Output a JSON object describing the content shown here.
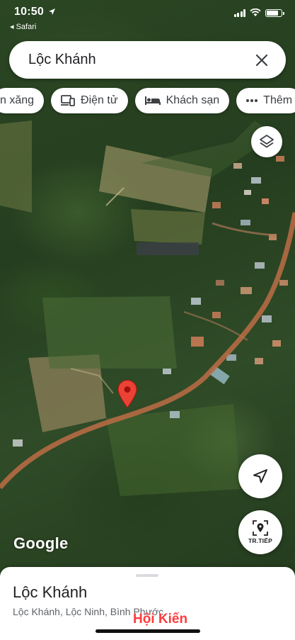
{
  "status_bar": {
    "time": "10:50",
    "back_app": "◂ Safari"
  },
  "search": {
    "query": "Lộc Khánh"
  },
  "chips": [
    {
      "label": "n xăng",
      "icon": ""
    },
    {
      "label": "Điện tử",
      "icon": "devices-icon"
    },
    {
      "label": "Khách sạn",
      "icon": "bed-icon"
    },
    {
      "label": "Thêm",
      "icon": "more-dots-icon"
    }
  ],
  "map": {
    "logo_text": "Google",
    "live_view_label": "TR.TIẾP",
    "pin_color": "#ea4335"
  },
  "place": {
    "name": "Lộc Khánh",
    "address": "Lộc Khánh, Lộc Ninh, Bình Phước"
  },
  "watermark": "Hội Kiến",
  "colors": {
    "accent_red": "#ea4335",
    "watermark_red": "#ff3b3b"
  }
}
